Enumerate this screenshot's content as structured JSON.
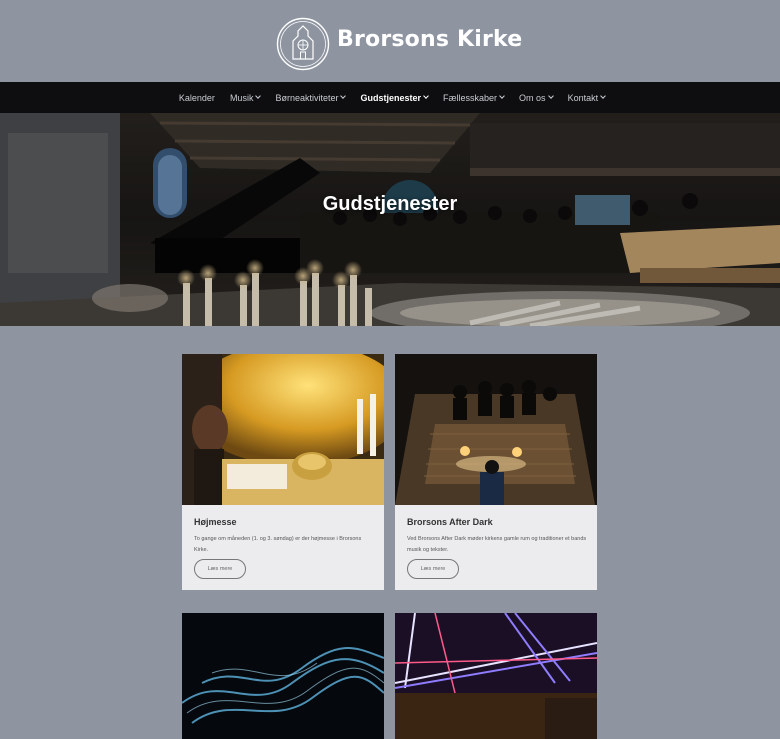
{
  "site": {
    "title": "Brorsons Kirke",
    "logo_icon": "church-icon"
  },
  "nav": {
    "items": [
      {
        "label": "Kalender",
        "dropdown": false
      },
      {
        "label": "Musik",
        "dropdown": true
      },
      {
        "label": "Børneaktiviteter",
        "dropdown": true
      },
      {
        "label": "Gudstjenester",
        "dropdown": true,
        "active": true
      },
      {
        "label": "Fællesskaber",
        "dropdown": true
      },
      {
        "label": "Om os",
        "dropdown": true
      },
      {
        "label": "Kontakt",
        "dropdown": true
      }
    ]
  },
  "hero": {
    "title": "Gudstjenester"
  },
  "cards": [
    {
      "title": "Højmesse",
      "text": "To gange om måneden (1. og 3. søndag) er der højmesse i Brorsons Kirke.",
      "button": "Læs mere"
    },
    {
      "title": "Brorsons After Dark",
      "text": "Ved Brorsons After Dark møder kirkens gamle rum og traditioner et bands musik og tekster.",
      "button": "Læs mere"
    }
  ],
  "colors": {
    "page_bg": "#8e95a1",
    "nav_bg": "#0e0e10",
    "card_bg": "#ececef"
  }
}
